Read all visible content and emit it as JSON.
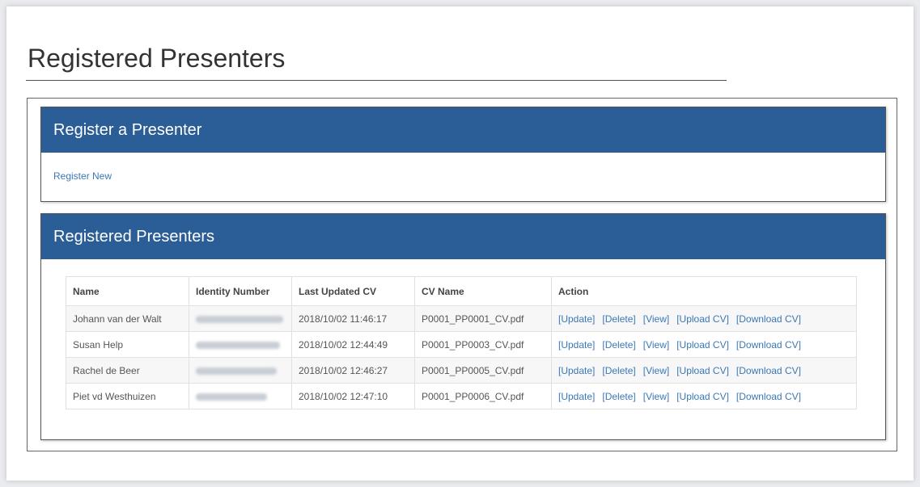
{
  "page": {
    "title": "Registered Presenters"
  },
  "register_panel": {
    "header": "Register a Presenter",
    "link_label": "Register New"
  },
  "list_panel": {
    "header": "Registered Presenters",
    "columns": [
      "Name",
      "Identity Number",
      "Last Updated CV",
      "CV Name",
      "Action"
    ],
    "rows": [
      {
        "name": "Johann van der Walt",
        "identity_number": "",
        "last_updated": "2018/10/02 11:46:17",
        "cv_name": "P0001_PP0001_CV.pdf"
      },
      {
        "name": "Susan Help",
        "identity_number": "",
        "last_updated": "2018/10/02 12:44:49",
        "cv_name": "P0001_PP0003_CV.pdf"
      },
      {
        "name": "Rachel de Beer",
        "identity_number": "",
        "last_updated": "2018/10/02 12:46:27",
        "cv_name": "P0001_PP0005_CV.pdf"
      },
      {
        "name": "Piet vd Westhuizen",
        "identity_number": "",
        "last_updated": "2018/10/02 12:47:10",
        "cv_name": "P0001_PP0006_CV.pdf"
      }
    ],
    "actions": [
      "[Update]",
      "[Delete]",
      "[View]",
      "[Upload CV]",
      "[Download CV]"
    ]
  },
  "colors": {
    "header_background": "#2b5d96",
    "link": "#3a78b8"
  }
}
